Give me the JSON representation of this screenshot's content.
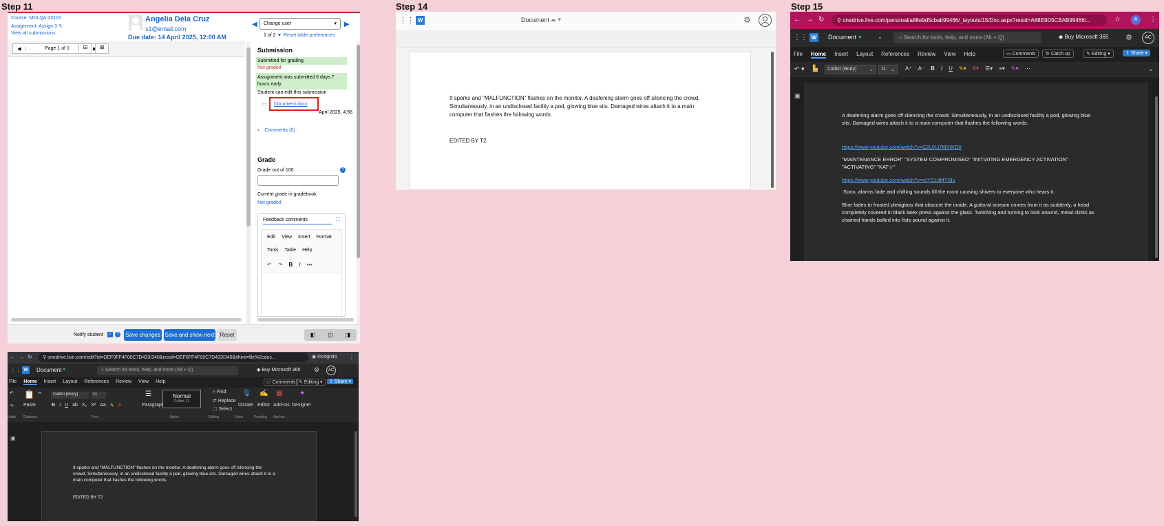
{
  "steps": {
    "s11": "Step 11",
    "s14": "Step 14",
    "s15": "Step 15"
  },
  "moodle": {
    "course": "Course: MDLQA-20115",
    "assignment": "Assignment: Assign 3",
    "view_all": "View all submissions",
    "student_name": "Angelia Dela Cruz",
    "student_email": "s1@email.com",
    "due_date": "Due date: 14 April 2025, 12:00 AM",
    "change_user": "Change user",
    "count": "1 of 2",
    "reset_prefs": "Reset table preferences",
    "page": "Page 1 of 1",
    "submission_heading": "Submission",
    "submitted": "Submitted for grading",
    "not_graded": "Not graded",
    "early": "Assignment was submitted 6 days 7 hours early",
    "can_edit": "Student can edit this submission",
    "file": "Document.docx",
    "file_date": "April 2025, 4:56",
    "comments": "Comments (0)",
    "grade_heading": "Grade",
    "grade_out_of": "Grade out of 100",
    "current_grade": "Current grade in gradebook",
    "current_value": "Not graded",
    "feedback": "Feedback comments",
    "editor_menu": [
      "Edit",
      "View",
      "Insert",
      "Format"
    ],
    "editor_menu2": [
      "Tools",
      "Table",
      "Help"
    ],
    "notify": "Notify student",
    "save": "Save changes",
    "save_next": "Save and show next",
    "reset": "Reset"
  },
  "word_small": {
    "url": "onedrive.live.com/edit?id=DEF0FF4F00C7D433!340&resid=DEF0FF4F00C7D433!340&ithint=file%2cdoc...",
    "incognito": "Incognito",
    "doc_name": "Document",
    "search": "Search for tools, help, and more (Alt + Q)",
    "buy": "Buy Microsoft 365",
    "avatar": "AC",
    "tabs": [
      "File",
      "Home",
      "Insert",
      "Layout",
      "References",
      "Review",
      "View",
      "Help"
    ],
    "comments": "Comments",
    "editing": "Editing",
    "share": "Share",
    "font": "Calibri (Body)",
    "size": "11",
    "paste": "Paste",
    "paragraph": "Paragraph",
    "style_name": "Normal",
    "style_sub": "Calibri, 11",
    "find": "Find",
    "replace": "Replace",
    "select": "Select",
    "dictate": "Dictate",
    "editor": "Editor",
    "addins": "Add-ins",
    "designer": "Designer",
    "groups": [
      "Undo",
      "Clipboard",
      "Font",
      "Styles",
      "Editing",
      "Voice",
      "Proofing",
      "Add-ins"
    ],
    "body": "It sparks and \"MALFUNCTION\" flashes on the monitor. A deafening alarm goes off silencing the crowd. Simultaneously, in an undisclosed facility a pod, glowing blue sits. Damaged wires attach it to a main computer that flashes the following words.",
    "edited": "EDITED BY T2"
  },
  "word_light": {
    "doc_name": "Document",
    "body": "It sparks and \"MALFUNCTION\" flashes on the monitor. A deafening alarm goes off silencing the crowd. Simultaneously, in an undisclosed facility a pod, glowing blue sits. Damaged wires attach it to a main computer that flashes the following words.",
    "edited": "EDITED BY T2"
  },
  "word_dark": {
    "url": "onedrive.live.com/personal/a88e9d5cbab99466/_layouts/15/Doc.aspx?resid=A88E9D5CBAB99466!...",
    "doc_name": "Document",
    "search": "Search for tools, help, and more (Alt + Q)",
    "buy": "Buy Microsoft 365",
    "avatar": "AC",
    "tabs": [
      "File",
      "Home",
      "Insert",
      "Layout",
      "References",
      "Review",
      "View",
      "Help"
    ],
    "comments": "Comments",
    "catchup": "Catch up",
    "editing": "Editing",
    "share": "Share",
    "font": "Calibri (Body)",
    "size": "11",
    "p1": "A deafening alarm goes off silencing the crowd. Simultaneously, in an undisclosed facility a pod, glowing blue sits. Damaged wires attach it to a main computer that flashes the following words.",
    "link1": "https://www.youtube.com/watch?v=C2UXJ7MXWO0",
    "p2": "\"MAINTENANCE ERROR\" \"SYSTEM COMPROMISED\" \"INITIATING EMERGENCY ACTIVATION\" \"ACTIVATING\" \"KAT☆\"",
    "link2": "https://www.youtube.com/watch?v=roYS1dMYSIs",
    "p3": "Soon, alarms fade and chilling sounds fill the room causing shivers to everyone who hears it.",
    "p4": "Blue fades to frosted plexiglass that obscure the inside. A guttural scream comes from it as suddenly, a head completely covered in black latex press against the glass. Twitching and turning to look around, metal clinks as chained hands balled into fists pound against it."
  },
  "colors": {
    "page_bg": "#f6d0d8",
    "moodle_blue": "#1f6fd1",
    "chrome_magenta": "#b0145a",
    "word_blue": "#2b7cd3"
  }
}
